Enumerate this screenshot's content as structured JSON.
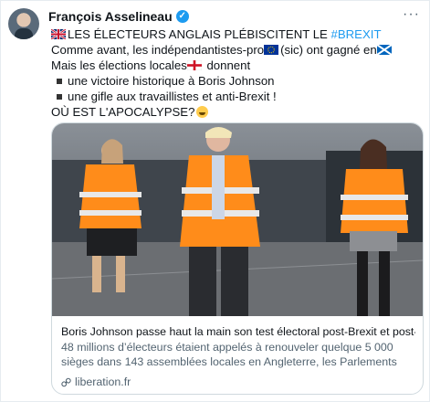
{
  "author": {
    "name": "François Asselineau",
    "verified": true
  },
  "tweet": {
    "line1_text": "LES ÉLECTEURS ANGLAIS PLÉBISCITENT LE ",
    "line1_hashtag": "#BREXIT",
    "line2_a": "Comme avant, les indépendantistes-pro",
    "line2_b": "(sic) ont gagné en",
    "line3_a": "Mais les élections locales",
    "line3_b": " donnent",
    "bullet1": "une victoire historique à Boris Johnson",
    "bullet2": "une gifle aux travaillistes et anti-Brexit !",
    "line6": "OÙ EST L'APOCALYPSE?"
  },
  "card": {
    "title": "Boris Johnson passe haut la main son test électoral post-Brexit et post-...",
    "description": "48 millions d’électeurs étaient appelés à renouveler quelque 5 000 sièges dans 143 assemblées locales en Angleterre, les Parlements gallois et ...",
    "domain": "liberation.fr"
  },
  "icons": [
    "verified-badge-icon",
    "more-options-icon",
    "uk-flag-icon",
    "eu-flag-icon",
    "scotland-flag-icon",
    "england-flag-icon",
    "laughing-emoji-icon",
    "link-icon"
  ],
  "colors": {
    "hashtag": "#1d9bf0",
    "verified": "#1d9bf0",
    "muted_text": "#536471",
    "vest_orange": "#ff8c1a"
  }
}
